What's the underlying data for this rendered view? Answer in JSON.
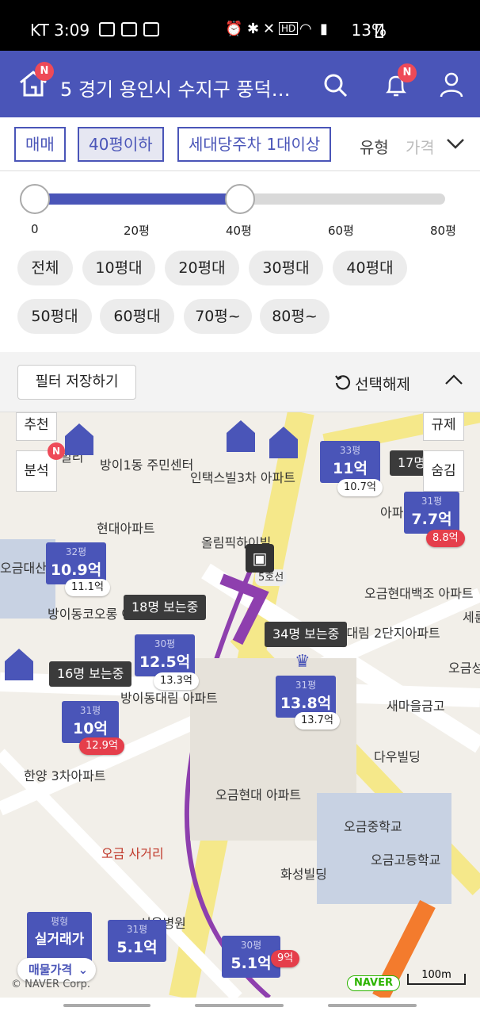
{
  "status": {
    "left": "KT 3:09",
    "right": "13%"
  },
  "header": {
    "badge": "N",
    "address": "5  경기 용인시 수지구 풍덕…",
    "notif_badge": "N"
  },
  "filters": {
    "chips": [
      "매매",
      "40평이하",
      "세대당주차 1대이상"
    ],
    "type_label": "유형",
    "price_label": "가격"
  },
  "slider": {
    "ticks": [
      "0",
      "20평",
      "40평",
      "60평",
      "80평"
    ],
    "min_value": 0,
    "max_value": 40,
    "range_max": 80
  },
  "size_pills": [
    "전체",
    "10평대",
    "20평대",
    "30평대",
    "40평대",
    "50평대",
    "60평대",
    "70평~",
    "80평~"
  ],
  "save": {
    "label": "필터 저장하기",
    "reset_label": "선택해제"
  },
  "map": {
    "buttons": {
      "recommend": "추천",
      "analysis": "분석",
      "regulation": "규제",
      "hide": "숨김",
      "analysis_badge": "N"
    },
    "labels": [
      "방이1동 주민센터",
      "인택스빌3차 아파트",
      "현대아파트",
      "올림픽하이빌",
      "5호선",
      "방이동코오롱 아파트",
      "방이동대림 아파트",
      "오금현대백조 아파트",
      "오금대림 2단지아파트",
      "새마을금고",
      "다우빌딩",
      "한양 3차아파트",
      "오금현대 아파트",
      "오금중학교",
      "오금고등학교",
      "화성빌딩",
      "오금 사거리",
      "서울병원",
      "오금성",
      "세륜",
      "오금대산",
      "아파",
      "빌리"
    ],
    "markers": [
      {
        "size": "33평",
        "price": "11억",
        "sub": "10.7억",
        "sub_red": false
      },
      {
        "size": "31평",
        "price": "7.7억",
        "sub": "8.8억",
        "sub_red": true
      },
      {
        "size": "32평",
        "price": "10.9억",
        "sub": "11.1억",
        "sub_red": false
      },
      {
        "size": "30평",
        "price": "12.5억",
        "sub": "13.3억",
        "sub_red": false
      },
      {
        "size": "31평",
        "price": "13.8억",
        "sub": "13.7억",
        "sub_red": false
      },
      {
        "size": "31평",
        "price": "10억",
        "sub": "12.9억",
        "sub_red": true
      },
      {
        "size": "31평",
        "price": "5.1억",
        "sub": "",
        "sub_red": false
      },
      {
        "size": "30평",
        "price": "5.1억",
        "sub": "9억",
        "sub_red": true
      }
    ],
    "watching": [
      "18명 보는중",
      "16명 보는중",
      "34명 보는중",
      "17명"
    ],
    "legend": {
      "title": "평형",
      "subtitle": "실거래가",
      "dropdown": "매물가격"
    },
    "copyright": "© NAVER Corp.",
    "naver": "NAVER",
    "scale": "100m"
  }
}
